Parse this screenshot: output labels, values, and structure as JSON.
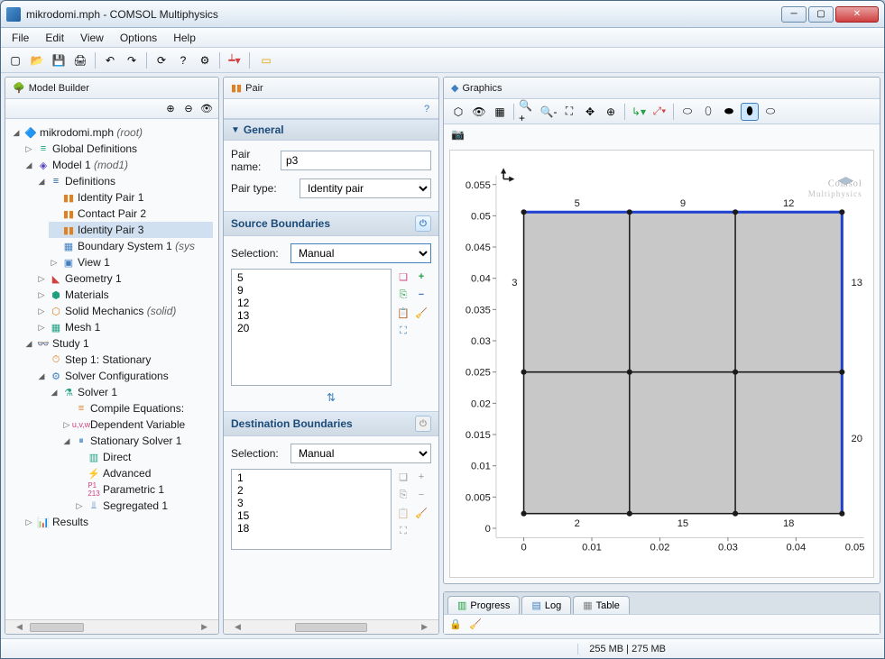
{
  "window": {
    "title": "mikrodomi.mph - COMSOL Multiphysics"
  },
  "menu": {
    "file": "File",
    "edit": "Edit",
    "view": "View",
    "options": "Options",
    "help": "Help"
  },
  "panels": {
    "modelBuilder": {
      "title": "Model Builder"
    },
    "pair": {
      "title": "Pair"
    },
    "graphics": {
      "title": "Graphics"
    }
  },
  "tree": {
    "root": "mikrodomi.mph",
    "rootSuffix": "(root)",
    "globalDefs": "Global Definitions",
    "model1": "Model 1",
    "model1Suffix": "(mod1)",
    "definitions": "Definitions",
    "identityPair1": "Identity Pair 1",
    "contactPair2": "Contact Pair 2",
    "identityPair3": "Identity Pair 3",
    "boundarySystem1": "Boundary System 1",
    "boundarySystem1Suffix": "(sys",
    "view1": "View 1",
    "geometry1": "Geometry 1",
    "materials": "Materials",
    "solidMechanics": "Solid Mechanics",
    "solidMechanicsSuffix": "(solid)",
    "mesh1": "Mesh 1",
    "study1": "Study 1",
    "step1": "Step 1: Stationary",
    "solverConfigs": "Solver Configurations",
    "solver1": "Solver 1",
    "compileEq": "Compile Equations:",
    "depVars": "Dependent Variable",
    "stationarySolver1": "Stationary Solver 1",
    "direct": "Direct",
    "advanced": "Advanced",
    "parametric1": "Parametric 1",
    "segregated1": "Segregated 1",
    "results": "Results"
  },
  "pair": {
    "generalHeader": "General",
    "pairNameLabel": "Pair name:",
    "pairNameValue": "p3",
    "pairTypeLabel": "Pair type:",
    "pairTypeValue": "Identity pair",
    "sourceHeader": "Source Boundaries",
    "selectionLabel": "Selection:",
    "selectionValue": "Manual",
    "sourceList": [
      "5",
      "9",
      "12",
      "13",
      "20"
    ],
    "destHeader": "Destination Boundaries",
    "destSelectionValue": "Manual",
    "destList": [
      "1",
      "2",
      "3",
      "15",
      "18"
    ]
  },
  "bottomTabs": {
    "progress": "Progress",
    "log": "Log",
    "table": "Table"
  },
  "status": {
    "memory": "255 MB | 275 MB"
  },
  "graphics": {
    "brand1": "Comsol",
    "brand2": "Multiphysics",
    "axis": {
      "yticks": [
        "0.055",
        "0.05",
        "0.045",
        "0.04",
        "0.035",
        "0.03",
        "0.025",
        "0.02",
        "0.015",
        "0.01",
        "0.005",
        "0"
      ],
      "xticks": [
        "0",
        "0.01",
        "0.02",
        "0.03",
        "0.04",
        "0.05"
      ]
    },
    "labels": {
      "top": {
        "5": "5",
        "9": "9",
        "12": "12"
      },
      "left": {
        "3": "3"
      },
      "right": {
        "13": "13",
        "20": "20"
      },
      "bottom": {
        "2": "2",
        "15": "15",
        "18": "18"
      }
    }
  }
}
